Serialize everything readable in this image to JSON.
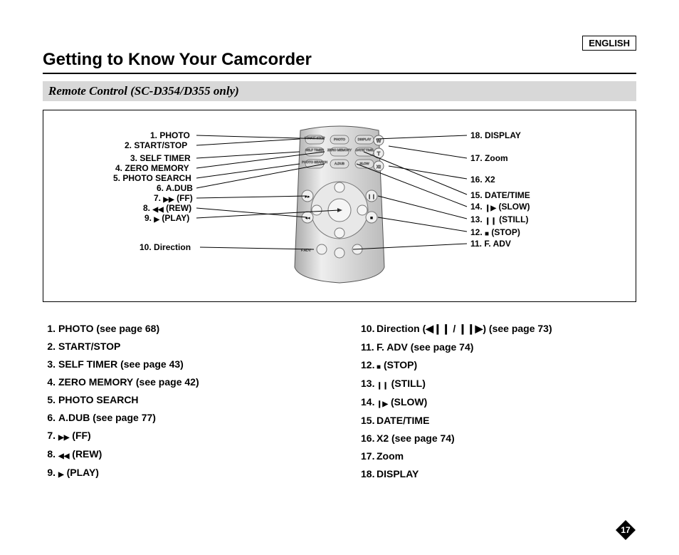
{
  "language": "ENGLISH",
  "title": "Getting to Know Your Camcorder",
  "subtitle": "Remote Control (SC-D354/D355 only)",
  "page_number": "17",
  "remote_buttons": {
    "row1": [
      "START/ STOP",
      "PHOTO",
      "DISPLAY"
    ],
    "row2": [
      "SELF TIMER",
      "ZERO MEMORY",
      "DATE/ TIME"
    ],
    "row3": [
      "PHOTO SEARCH",
      "A.DUB",
      "SLOW"
    ],
    "zoom": [
      "W",
      "T"
    ],
    "x2": "X2",
    "fadv": "F.ADV"
  },
  "callouts_left": [
    {
      "n": "1.",
      "t": "PHOTO"
    },
    {
      "n": "2.",
      "t": "START/STOP"
    },
    {
      "n": "3.",
      "t": "SELF TIMER"
    },
    {
      "n": "4.",
      "t": "ZERO MEMORY"
    },
    {
      "n": "5.",
      "t": "PHOTO SEARCH"
    },
    {
      "n": "6.",
      "t": "A.DUB"
    },
    {
      "n": "7.",
      "t": "(FF)",
      "icon": "▶▶"
    },
    {
      "n": "8.",
      "t": "(REW)",
      "icon": "◀◀"
    },
    {
      "n": "9.",
      "t": "(PLAY)",
      "icon": "▶"
    },
    {
      "n": "10.",
      "t": "Direction"
    }
  ],
  "callouts_right": [
    {
      "n": "18.",
      "t": "DISPLAY"
    },
    {
      "n": "17.",
      "t": "Zoom"
    },
    {
      "n": "16.",
      "t": "X2"
    },
    {
      "n": "15.",
      "t": "DATE/TIME"
    },
    {
      "n": "14.",
      "t": "(SLOW)",
      "icon": "❙▶"
    },
    {
      "n": "13.",
      "t": "(STILL)",
      "icon": "❙❙"
    },
    {
      "n": "12.",
      "t": "(STOP)",
      "icon": "■"
    },
    {
      "n": "11.",
      "t": "F. ADV"
    }
  ],
  "list_left": [
    {
      "n": "1.",
      "t": "PHOTO (see page 68)"
    },
    {
      "n": "2.",
      "t": "START/STOP"
    },
    {
      "n": "3.",
      "t": "SELF TIMER (see page 43)"
    },
    {
      "n": "4.",
      "t": "ZERO MEMORY (see page 42)"
    },
    {
      "n": "5.",
      "t": "PHOTO SEARCH"
    },
    {
      "n": "6.",
      "t": "A.DUB (see page 77)"
    },
    {
      "n": "7.",
      "t": "(FF)",
      "icon": "▶▶"
    },
    {
      "n": "8.",
      "t": "(REW)",
      "icon": "◀◀"
    },
    {
      "n": "9.",
      "t": "(PLAY)",
      "icon": "▶"
    }
  ],
  "list_right": [
    {
      "n": "10.",
      "t": "Direction (◀❙❙ / ❙❙▶) (see page 73)"
    },
    {
      "n": "11.",
      "t": "F. ADV  (see page 74)"
    },
    {
      "n": "12.",
      "t": "(STOP)",
      "icon": "■"
    },
    {
      "n": "13.",
      "t": "(STILL)",
      "icon": "❙❙"
    },
    {
      "n": "14.",
      "t": "(SLOW)",
      "icon": "❙▶"
    },
    {
      "n": "15.",
      "t": "DATE/TIME"
    },
    {
      "n": "16.",
      "t": "X2 (see page 74)"
    },
    {
      "n": "17.",
      "t": "Zoom"
    },
    {
      "n": "18.",
      "t": "DISPLAY"
    }
  ]
}
